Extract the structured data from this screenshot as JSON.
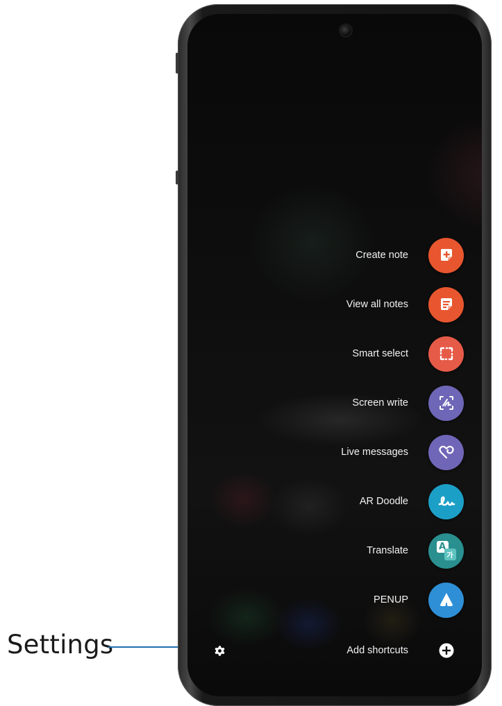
{
  "callout": {
    "label": "Settings"
  },
  "menu": {
    "items": [
      {
        "label": "Create note",
        "icon": "create-note-icon",
        "color": "#e8562f"
      },
      {
        "label": "View all notes",
        "icon": "view-notes-icon",
        "color": "#e8562f"
      },
      {
        "label": "Smart select",
        "icon": "smart-select-icon",
        "color": "#e65a48"
      },
      {
        "label": "Screen write",
        "icon": "screen-write-icon",
        "color": "#6e66b6"
      },
      {
        "label": "Live messages",
        "icon": "live-messages-icon",
        "color": "#7066b8"
      },
      {
        "label": "AR Doodle",
        "icon": "ar-doodle-icon",
        "color": "#1c9fc7"
      },
      {
        "label": "Translate",
        "icon": "translate-icon",
        "color": "#2a8f8f"
      },
      {
        "label": "PENUP",
        "icon": "penup-icon",
        "color": "#2e8fd6"
      }
    ],
    "add_shortcuts": "Add shortcuts",
    "translate_glyphs": {
      "latin": "A",
      "korean": "가"
    }
  }
}
